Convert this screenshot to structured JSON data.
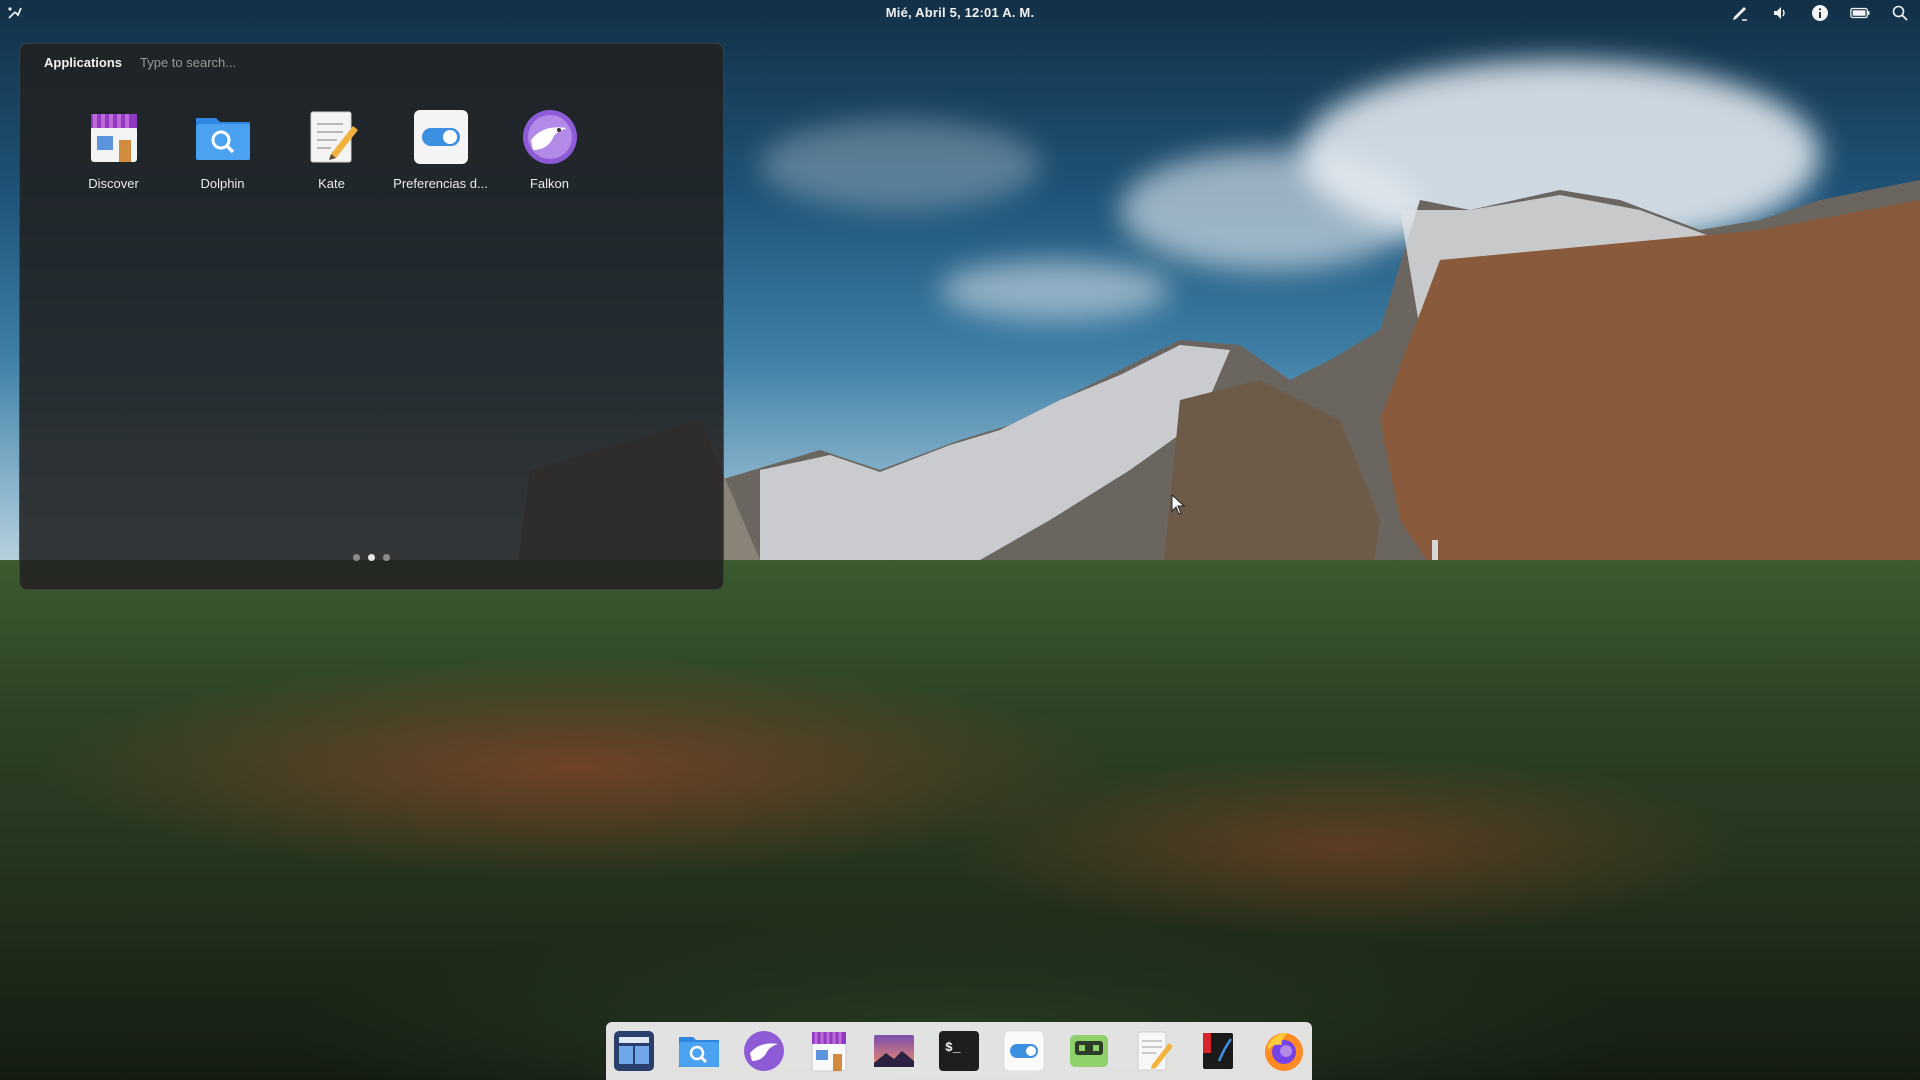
{
  "topbar": {
    "clock": "Mié, Abril 5, 12:01 A. M.",
    "tray_icons": [
      "pen-icon",
      "volume-icon",
      "info-icon",
      "battery-icon",
      "search-icon"
    ]
  },
  "launcher": {
    "category": "Applications",
    "search_placeholder": "Type to search...",
    "apps": [
      {
        "label": "Discover",
        "icon": "store-icon"
      },
      {
        "label": "Dolphin",
        "icon": "folder-search-icon"
      },
      {
        "label": "Kate",
        "icon": "text-editor-icon"
      },
      {
        "label": "Preferencias d...",
        "icon": "toggle-settings-icon"
      },
      {
        "label": "Falkon",
        "icon": "falkon-icon"
      }
    ],
    "pages": 3,
    "active_page": 2
  },
  "dock": {
    "items": [
      "window-manager-icon",
      "dolphin-icon",
      "falkon-icon",
      "discover-icon",
      "image-viewer-icon",
      "terminal-icon",
      "settings-toggle-icon",
      "robot-icon",
      "kate-icon",
      "book-icon",
      "firefox-icon"
    ],
    "terminal_glyph": "$_"
  },
  "colors": {
    "launcher_bg": "#212121",
    "dock_bg": "#f0f0f0",
    "accent_blue": "#3d8fe0"
  }
}
